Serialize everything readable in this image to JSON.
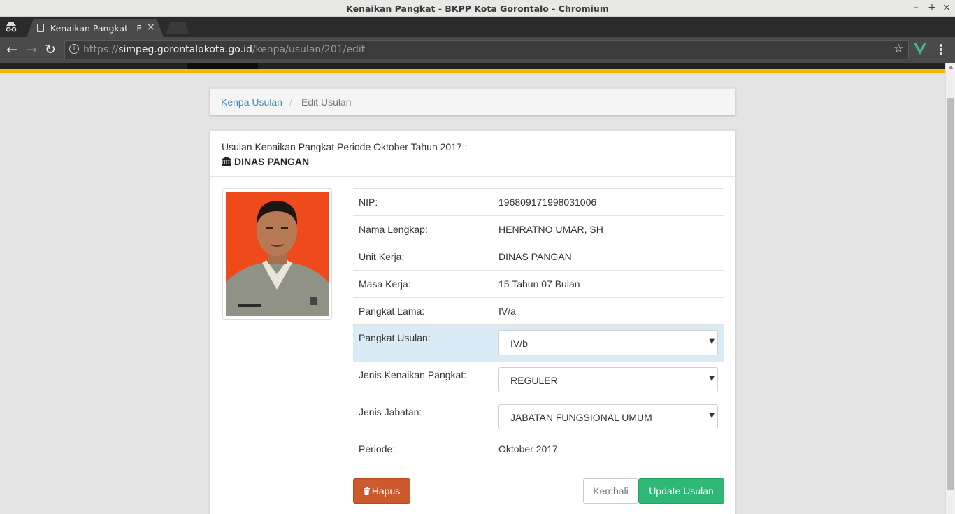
{
  "window": {
    "title": "Kenaikan Pangkat - BKPP Kota Gorontalo - Chromium",
    "controls": [
      "–",
      "+",
      "×"
    ]
  },
  "tabs": [
    {
      "title": "Kenaikan Pangkat - BKPP Kota Gorontalo",
      "close": "×",
      "favicon": "page-icon"
    }
  ],
  "toolbar": {
    "back": "←",
    "forward": "→",
    "reload": "↻",
    "url_scheme": "https://",
    "url_host": "simpeg.gorontalokota.go.id",
    "url_path": "/kenpa/usulan/201/edit",
    "star": "☆",
    "extension_icon": "vue-devtools-icon"
  },
  "breadcrumb": {
    "link": "Kenpa Usulan",
    "separator": "/",
    "active": "Edit Usulan"
  },
  "panel": {
    "subtitle": "Usulan Kenaikan Pangkat Periode Oktober Tahun 2017 :",
    "unit": "DINAS PANGAN",
    "unit_icon": "institution-icon"
  },
  "details": {
    "nip_label": "NIP:",
    "nip": "196809171998031006",
    "name_label": "Nama Lengkap:",
    "name": "HENRATNO UMAR, SH",
    "unit_label": "Unit Kerja:",
    "unit": "DINAS PANGAN",
    "service_label": "Masa Kerja:",
    "service": "15 Tahun 07 Bulan",
    "old_rank_label": "Pangkat Lama:",
    "old_rank": "IV/a",
    "proposed_rank_label": "Pangkat Usulan:",
    "proposed_rank": "IV/b",
    "promotion_type_label": "Jenis Kenaikan Pangkat:",
    "promotion_type": "REGULER",
    "position_type_label": "Jenis Jabatan:",
    "position_type": "JABATAN FUNGSIONAL UMUM",
    "period_label": "Periode:",
    "period": "Oktober 2017"
  },
  "actions": {
    "delete": "Hapus",
    "back": "Kembali",
    "update": "Update Usulan"
  },
  "colors": {
    "accent_bar": "#f4b800",
    "link": "#3c8dbc",
    "danger": "#cc5a2c",
    "success": "#2fb875",
    "highlight_row": "#d9ecf5"
  }
}
